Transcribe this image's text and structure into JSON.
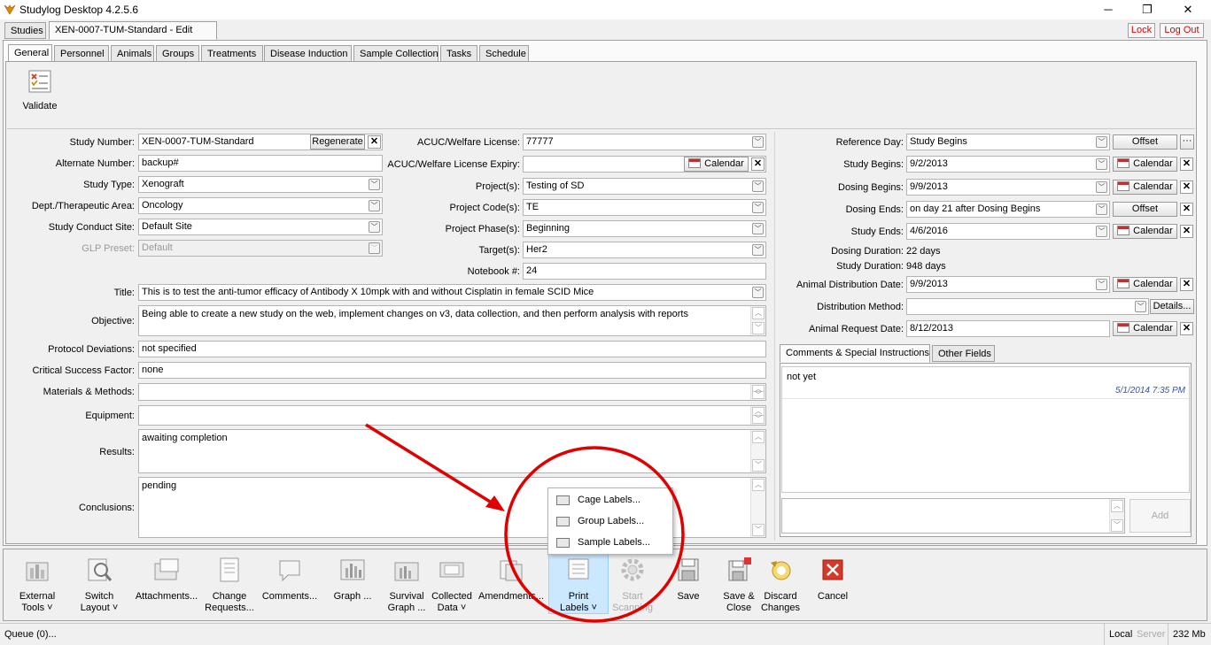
{
  "window": {
    "title": "Studylog Desktop 4.2.5.6",
    "minimize": "─",
    "restore": "❐",
    "close": "✕"
  },
  "doc_tabs": [
    {
      "label": "Studies"
    },
    {
      "label": "XEN-0007-TUM-Standard - Edit"
    }
  ],
  "top_buttons": {
    "lock": "Lock",
    "logout": "Log Out"
  },
  "section_tabs": [
    {
      "label": "General"
    },
    {
      "label": "Personnel"
    },
    {
      "label": "Animals"
    },
    {
      "label": "Groups"
    },
    {
      "label": "Treatments"
    },
    {
      "label": "Disease Induction"
    },
    {
      "label": "Sample Collection"
    },
    {
      "label": "Tasks"
    },
    {
      "label": "Schedule"
    }
  ],
  "ribbon": {
    "validate": "Validate"
  },
  "left": {
    "study_number": {
      "label": "Study Number:",
      "value": "XEN-0007-TUM-Standard",
      "button": "Regenerate"
    },
    "alternate_number": {
      "label": "Alternate Number:",
      "value": "backup#"
    },
    "study_type": {
      "label": "Study Type:",
      "value": "Xenograft"
    },
    "dept": {
      "label": "Dept./Therapeutic Area:",
      "value": "Oncology"
    },
    "site": {
      "label": "Study Conduct Site:",
      "value": "Default Site"
    },
    "glp": {
      "label": "GLP Preset:",
      "value": "Default"
    }
  },
  "middle": {
    "acuc": {
      "label": "ACUC/Welfare License:",
      "value": "77777"
    },
    "acuc_expiry": {
      "label": "ACUC/Welfare License Expiry:",
      "value": "",
      "button": "Calendar"
    },
    "projects": {
      "label": "Project(s):",
      "value": "Testing of SD"
    },
    "project_codes": {
      "label": "Project Code(s):",
      "value": "TE"
    },
    "project_phases": {
      "label": "Project Phase(s):",
      "value": "Beginning"
    },
    "targets": {
      "label": "Target(s):",
      "value": "Her2"
    },
    "notebook": {
      "label": "Notebook #:",
      "value": "24"
    }
  },
  "wide": {
    "title": {
      "label": "Title:",
      "value": "This is to test the anti-tumor efficacy of Antibody X 10mpk with and without Cisplatin in female SCID Mice"
    },
    "objective": {
      "label": "Objective:",
      "value": "Being able to create a new study on the web, implement changes on v3, data collection, and then perform analysis with reports"
    },
    "protocol_deviations": {
      "label": "Protocol Deviations:",
      "value": "not specified"
    },
    "critical_success": {
      "label": "Critical Success Factor:",
      "value": "none"
    },
    "materials": {
      "label": "Materials & Methods:",
      "value": ""
    },
    "equipment": {
      "label": "Equipment:",
      "value": ""
    },
    "results": {
      "label": "Results:",
      "value": "awaiting completion"
    },
    "conclusions": {
      "label": "Conclusions:",
      "value": "pending"
    }
  },
  "right": {
    "reference_day": {
      "label": "Reference Day:",
      "value": "Study Begins",
      "button": "Offset",
      "more": "···"
    },
    "study_begins": {
      "label": "Study Begins:",
      "value": "9/2/2013",
      "button": "Calendar"
    },
    "dosing_begins": {
      "label": "Dosing Begins:",
      "value": "9/9/2013",
      "button": "Calendar"
    },
    "dosing_ends": {
      "label": "Dosing Ends:",
      "value": "on day 21 after Dosing Begins",
      "button": "Offset"
    },
    "study_ends": {
      "label": "Study Ends:",
      "value": "4/6/2016",
      "button": "Calendar"
    },
    "dosing_duration": {
      "label": "Dosing Duration:",
      "value": "22 days"
    },
    "study_duration": {
      "label": "Study Duration:",
      "value": "948 days"
    },
    "animal_distribution": {
      "label": "Animal Distribution Date:",
      "value": "9/9/2013",
      "button": "Calendar"
    },
    "distribution_method": {
      "label": "Distribution Method:",
      "value": "",
      "button": "Details..."
    },
    "animal_request": {
      "label": "Animal Request Date:",
      "value": "8/12/2013",
      "button": "Calendar"
    },
    "tabs": [
      {
        "label": "Comments & Special Instructions"
      },
      {
        "label": "Other Fields"
      }
    ],
    "comment": {
      "text": "not yet",
      "timestamp": "5/1/2014 7:35 PM"
    },
    "add_button": "Add"
  },
  "toolbar": [
    {
      "line1": "External",
      "line2": "Tools ˅"
    },
    {
      "line1": "Switch",
      "line2": "Layout ˅"
    },
    {
      "line1": "Attachments...",
      "line2": ""
    },
    {
      "line1": "Change",
      "line2": "Requests..."
    },
    {
      "line1": "Comments...",
      "line2": ""
    },
    {
      "line1": "Graph ...",
      "line2": ""
    },
    {
      "line1": "Survival",
      "line2": "Graph ..."
    },
    {
      "line1": "Collected",
      "line2": "Data ˅"
    },
    {
      "line1": "Amendments...",
      "line2": ""
    },
    {
      "line1": "Print",
      "line2": "Labels ˅"
    },
    {
      "line1": "Start",
      "line2": "Scanning"
    },
    {
      "line1": "Save",
      "line2": ""
    },
    {
      "line1": "Save &",
      "line2": "Close"
    },
    {
      "line1": "Discard",
      "line2": "Changes"
    },
    {
      "line1": "Cancel",
      "line2": ""
    }
  ],
  "print_menu": [
    {
      "label": "Cage Labels..."
    },
    {
      "label": "Group Labels..."
    },
    {
      "label": "Sample Labels..."
    }
  ],
  "status": {
    "queue": "Queue (0)...",
    "local": "Local",
    "server": "Server",
    "memory": "232 Mb"
  },
  "colors": {
    "accent_red": "#e00000",
    "selected_blue": "#cce8ff",
    "link_blue": "#3355aa"
  }
}
